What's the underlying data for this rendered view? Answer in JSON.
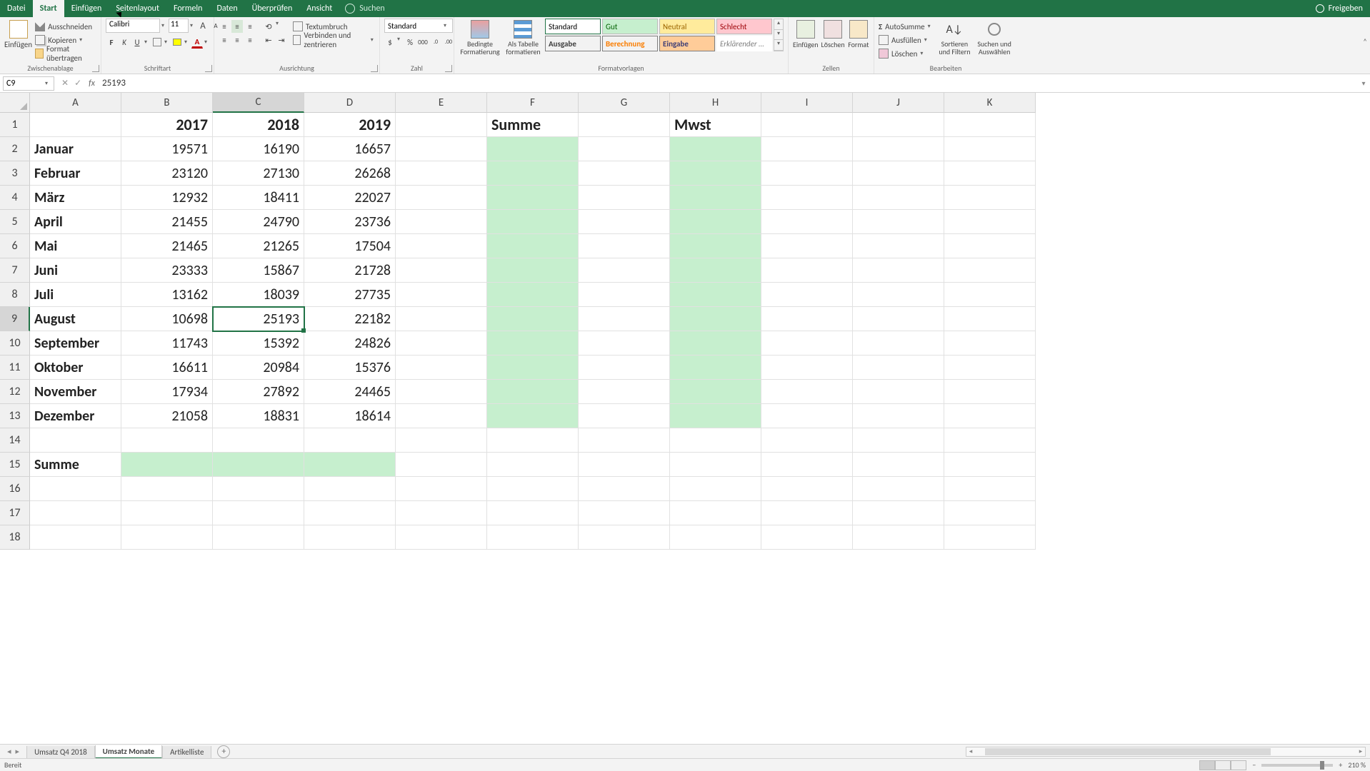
{
  "titlebar": {
    "tabs": [
      "Datei",
      "Start",
      "Einfügen",
      "Seitenlayout",
      "Formeln",
      "Daten",
      "Überprüfen",
      "Ansicht"
    ],
    "active_tab": "Start",
    "search_placeholder": "Suchen",
    "share": "Freigeben"
  },
  "ribbon": {
    "clipboard": {
      "paste": "Einfügen",
      "cut": "Ausschneiden",
      "copy": "Kopieren",
      "format_painter": "Format übertragen",
      "label": "Zwischenablage"
    },
    "font": {
      "name": "Calibri",
      "size": "11",
      "bold": "F",
      "italic": "K",
      "underline": "U",
      "label": "Schriftart"
    },
    "alignment": {
      "wrap": "Textumbruch",
      "merge": "Verbinden und zentrieren",
      "label": "Ausrichtung"
    },
    "number": {
      "format": "Standard",
      "label": "Zahl"
    },
    "styles": {
      "conditional": "Bedingte Formatierung",
      "as_table": "Als Tabelle formatieren",
      "gallery": [
        {
          "text": "Standard",
          "bg": "#ffffff",
          "color": "#000",
          "border": "#217346",
          "bold": false
        },
        {
          "text": "Gut",
          "bg": "#c6efce",
          "color": "#006100",
          "border": "#bbb",
          "bold": false
        },
        {
          "text": "Neutral",
          "bg": "#ffeb9c",
          "color": "#9c6500",
          "border": "#bbb",
          "bold": false
        },
        {
          "text": "Schlecht",
          "bg": "#ffc7ce",
          "color": "#9c0006",
          "border": "#bbb",
          "bold": false
        },
        {
          "text": "Ausgabe",
          "bg": "#f2f2f2",
          "color": "#3f3f3f",
          "border": "#7f7f7f",
          "bold": true
        },
        {
          "text": "Berechnung",
          "bg": "#f2f2f2",
          "color": "#fa7d00",
          "border": "#7f7f7f",
          "bold": true
        },
        {
          "text": "Eingabe",
          "bg": "#ffcc99",
          "color": "#3f3f76",
          "border": "#7f7f7f",
          "bold": true
        },
        {
          "text": "Erklärender …",
          "bg": "#ffffff",
          "color": "#7f7f7f",
          "border": "#fff",
          "bold": false,
          "italic": true
        }
      ],
      "label": "Formatvorlagen"
    },
    "cells": {
      "insert": "Einfügen",
      "delete": "Löschen",
      "format": "Format",
      "label": "Zellen"
    },
    "editing": {
      "autosum": "AutoSumme",
      "fill": "Ausfüllen",
      "clear": "Löschen",
      "sort": "Sortieren und Filtern",
      "find": "Suchen und Auswählen",
      "label": "Bearbeiten"
    }
  },
  "namebox": "C9",
  "formula": "25193",
  "columns": [
    "A",
    "B",
    "C",
    "D",
    "E",
    "F",
    "G",
    "H",
    "I",
    "J",
    "K"
  ],
  "selected_col": "C",
  "selected_row": 9,
  "sheet": {
    "headers": {
      "B": "2017",
      "C": "2018",
      "D": "2019",
      "F": "Summe",
      "H": "Mwst"
    },
    "rows": [
      {
        "m": "Januar",
        "b": "19571",
        "c": "16190",
        "d": "16657"
      },
      {
        "m": "Februar",
        "b": "23120",
        "c": "27130",
        "d": "26268"
      },
      {
        "m": "März",
        "b": "12932",
        "c": "18411",
        "d": "22027"
      },
      {
        "m": "April",
        "b": "21455",
        "c": "24790",
        "d": "23736"
      },
      {
        "m": "Mai",
        "b": "21465",
        "c": "21265",
        "d": "17504"
      },
      {
        "m": "Juni",
        "b": "23333",
        "c": "15867",
        "d": "21728"
      },
      {
        "m": "Juli",
        "b": "13162",
        "c": "18039",
        "d": "27735"
      },
      {
        "m": "August",
        "b": "10698",
        "c": "25193",
        "d": "22182"
      },
      {
        "m": "September",
        "b": "11743",
        "c": "15392",
        "d": "24826"
      },
      {
        "m": "Oktober",
        "b": "16611",
        "c": "20984",
        "d": "15376"
      },
      {
        "m": "November",
        "b": "17934",
        "c": "27892",
        "d": "24465"
      },
      {
        "m": "Dezember",
        "b": "21058",
        "c": "18831",
        "d": "18614"
      }
    ],
    "summe_label": "Summe"
  },
  "sheettabs": {
    "tabs": [
      "Umsatz Q4 2018",
      "Umsatz Monate",
      "Artikelliste"
    ],
    "active": "Umsatz Monate"
  },
  "statusbar": {
    "ready": "Bereit",
    "zoom": "210 %"
  }
}
